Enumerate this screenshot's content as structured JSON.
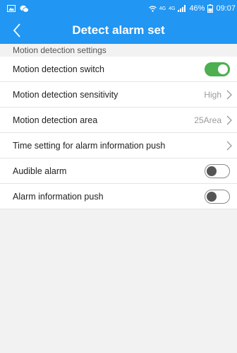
{
  "status_bar": {
    "left_icons": [
      "image-icon",
      "wechat-icon"
    ],
    "right_icons": [
      "wifi-icon",
      "4g-signal-icon",
      "battery-icon"
    ],
    "net_top": "4G",
    "net_bottom": "4G",
    "battery": "46%",
    "time": "09:07"
  },
  "header": {
    "title": "Detect alarm set",
    "back_icon": "chevron-left-icon"
  },
  "section": {
    "title": "Motion detection settings"
  },
  "settings": {
    "motion_switch": {
      "label": "Motion detection switch",
      "state": true
    },
    "sensitivity": {
      "label": "Motion detection sensitivity",
      "value": "High"
    },
    "area": {
      "label": "Motion detection area",
      "value": "25Area"
    },
    "time_setting": {
      "label": "Time setting for alarm information push"
    },
    "audible_alarm": {
      "label": "Audible alarm",
      "state": false
    },
    "info_push": {
      "label": "Alarm information push",
      "state": false
    }
  },
  "colors": {
    "primary": "#2196f3",
    "toggle_on": "#4caf50",
    "background": "#f2f2f2"
  }
}
